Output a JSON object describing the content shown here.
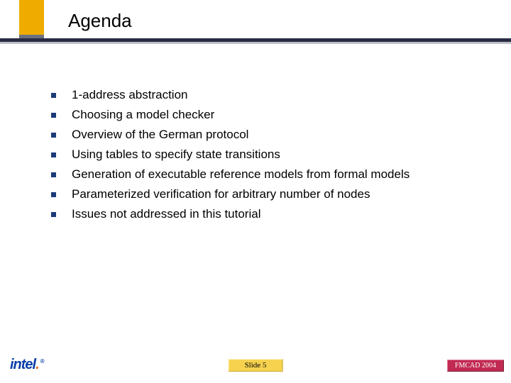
{
  "title": "Agenda",
  "bullets": [
    "1-address abstraction",
    "Choosing a model checker",
    "Overview of the German protocol",
    "Using tables to specify state transitions",
    "Generation of executable reference models from formal models",
    "Parameterized verification for arbitrary number of nodes",
    "Issues not addressed in this tutorial"
  ],
  "footer": {
    "logo_text": "intel",
    "logo_dot": ".",
    "slide_label": "Slide 5",
    "conference": "FMCAD 2004"
  }
}
